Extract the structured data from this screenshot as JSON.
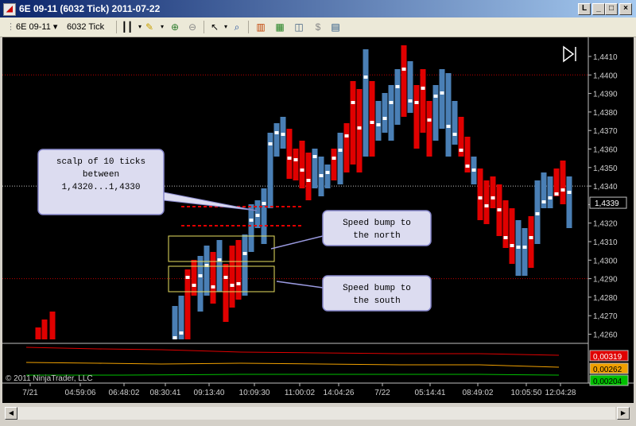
{
  "window": {
    "title": "6E 09-11 (6032 Tick)  2011-07-22",
    "app_icon": "ninjatrader-chart-icon",
    "buttons": [
      "_",
      "□",
      "×"
    ],
    "inner_button": "L"
  },
  "toolbar": {
    "instrument": "6E 09-11",
    "interval": "6032 Tick"
  },
  "price_axis": {
    "labels": [
      "1,4410",
      "1,4400",
      "1,4390",
      "1,4380",
      "1,4370",
      "1,4360",
      "1,4350",
      "1,4340",
      "1,4330",
      "1,4320",
      "1,4310",
      "1,4300",
      "1,4290",
      "1,4280",
      "1,4270",
      "1,4260"
    ],
    "current_price": "1,4339"
  },
  "time_axis": {
    "labels": [
      "7/21",
      "04:59:06",
      "06:48:02",
      "08:30:41",
      "09:13:40",
      "10:09:30",
      "11:00:02",
      "14:04:26",
      "7/22",
      "05:14:41",
      "08:49:02",
      "10:05:50",
      "12:04:28"
    ]
  },
  "indicator": {
    "values": [
      "0,00319",
      "0,00262",
      "0,00204"
    ],
    "colors": [
      "#e00000",
      "#f0a000",
      "#00c000"
    ]
  },
  "copyright": "© 2011 NinjaTrader, LLC",
  "annotations": {
    "scalp": [
      "scalp of 10 ticks",
      "between",
      "1,4320...1,4330"
    ],
    "north": [
      "Speed bump to",
      "the north"
    ],
    "south": [
      "Speed bump to",
      "the south"
    ]
  },
  "colors": {
    "up_bar": "#4a7fb5",
    "down_bar": "#e00000",
    "background": "#000000",
    "callout": "#dcdcf0"
  }
}
